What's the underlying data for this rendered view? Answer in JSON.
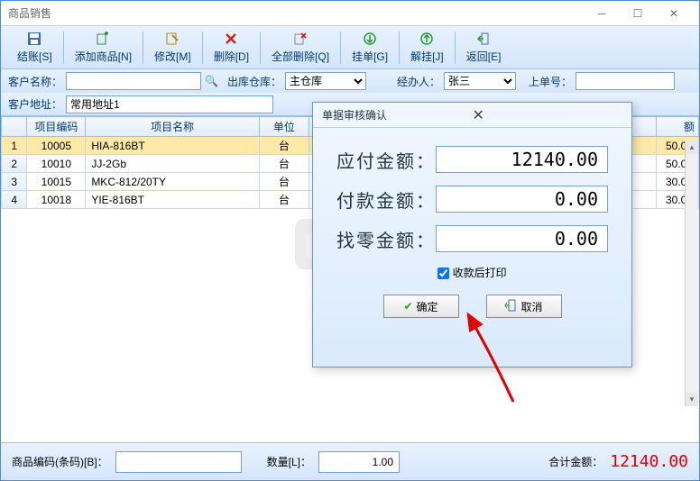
{
  "window": {
    "title": "商品销售"
  },
  "toolbar": [
    {
      "icon": "save",
      "label": "结账[S]"
    },
    {
      "icon": "add",
      "label": "添加商品[N]"
    },
    {
      "icon": "edit",
      "label": "修改[M]"
    },
    {
      "icon": "del",
      "label": "删除[D]"
    },
    {
      "icon": "delall",
      "label": "全部删除[Q]"
    },
    {
      "icon": "hold",
      "label": "挂单[G]"
    },
    {
      "icon": "unhold",
      "label": "解挂[J]"
    },
    {
      "icon": "back",
      "label": "返回[E]"
    }
  ],
  "form": {
    "customer_name_label": "客户名称：",
    "customer_name": "",
    "warehouse_label": "出库仓库：",
    "warehouse": "主仓库",
    "handler_label": "经办人：",
    "handler": "张三",
    "order_no_label": "上单号：",
    "order_no": "",
    "address_label": "客户地址：",
    "address": "常用地址1"
  },
  "grid": {
    "cols": [
      "",
      "项目编码",
      "项目名称",
      "单位",
      "额"
    ],
    "rows": [
      {
        "n": "1",
        "code": "10005",
        "name": "HIA-816BT",
        "unit": "台",
        "amt": "50.00",
        "sel": true
      },
      {
        "n": "2",
        "code": "10010",
        "name": "JJ-2Gb",
        "unit": "台",
        "amt": "50.00"
      },
      {
        "n": "3",
        "code": "10015",
        "name": "MKC-812/20TY",
        "unit": "台",
        "amt": "30.00"
      },
      {
        "n": "4",
        "code": "10018",
        "name": "YIE-816BT",
        "unit": "台",
        "amt": "30.00"
      }
    ]
  },
  "footer": {
    "barcode_label": "商品编码(条码)[B]：",
    "barcode": "",
    "qty_label": "数量[L]：",
    "qty": "1.00",
    "total_label": "合计金额：",
    "total": "12140.00"
  },
  "modal": {
    "title": "单据审核确认",
    "payable_label": "应付金额：",
    "payable": "12140.00",
    "paid_label": "付款金额：",
    "paid": "0.00",
    "change_label": "找零金额：",
    "change": "0.00",
    "print_label": "收款后打印",
    "ok": "确定",
    "cancel": "取消"
  }
}
